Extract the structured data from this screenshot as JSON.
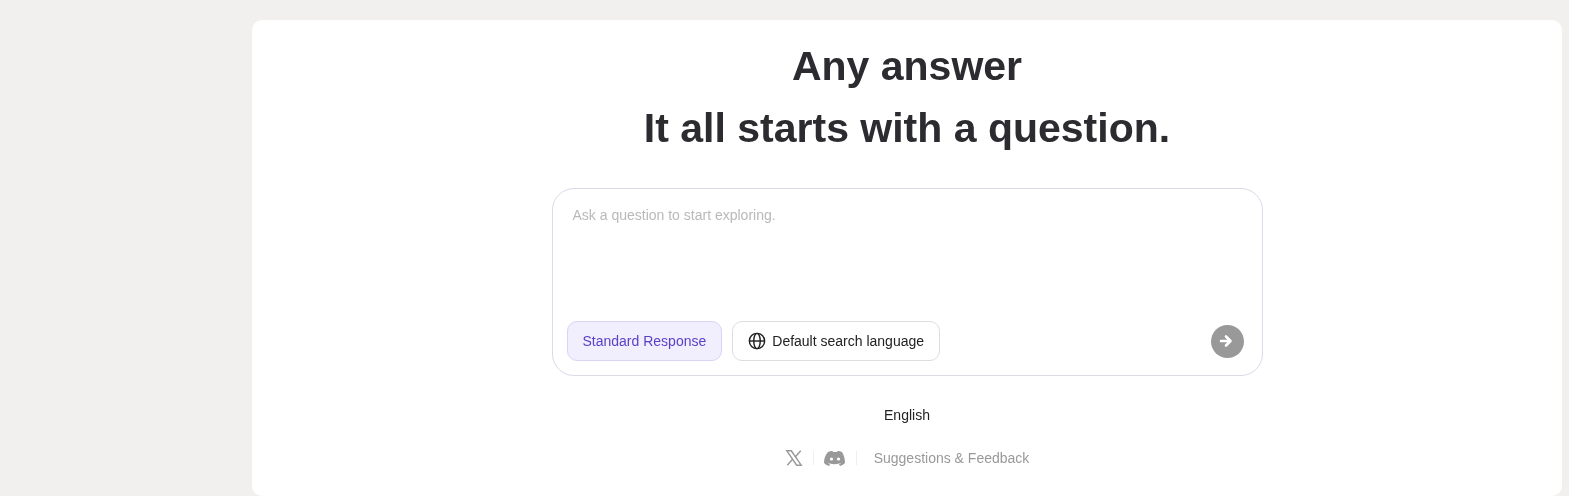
{
  "headline": [
    "Any answer",
    "It all starts with a question."
  ],
  "search": {
    "placeholder": "Ask a question to start exploring."
  },
  "options": [
    {
      "label": "Standard Response",
      "kind": "mode",
      "selected": true
    },
    {
      "label": "Default search language",
      "kind": "language",
      "selected": false
    }
  ],
  "language": "English",
  "footer": {
    "link": "Suggestions & Feedback"
  }
}
